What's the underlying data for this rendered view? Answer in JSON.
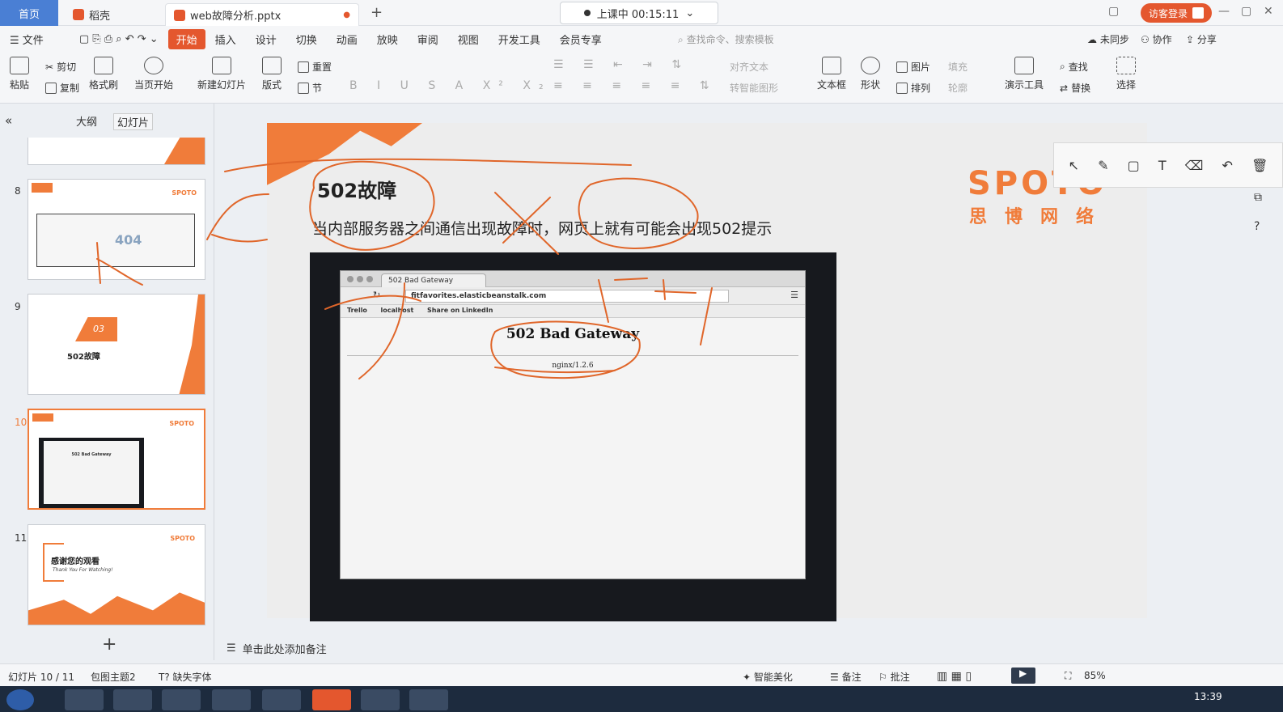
{
  "tabs": {
    "home": "首页",
    "daoke": "稻壳",
    "file": "web故障分析.pptx",
    "recording": "上课中 00:15:11",
    "login": "访客登录"
  },
  "menu": {
    "file": "文件",
    "items": [
      "开始",
      "插入",
      "设计",
      "切换",
      "动画",
      "放映",
      "审阅",
      "视图",
      "开发工具",
      "会员专享"
    ],
    "search_placeholder": "查找命令、搜索模板",
    "sync": "未同步",
    "collab": "协作",
    "share": "分享"
  },
  "ribbon": {
    "paste": "粘贴",
    "cut": "剪切",
    "copy": "复制",
    "format_painter": "格式刷",
    "from_current": "当页开始",
    "new_slide": "新建幻灯片",
    "layout": "版式",
    "reset": "重置",
    "section": "节",
    "align_text": "对齐文本",
    "smart_art": "转智能图形",
    "textbox": "文本框",
    "shape": "形状",
    "picture": "图片",
    "arrange": "排列",
    "fill": "填充",
    "outline": "轮廓",
    "presenter": "演示工具",
    "find": "查找",
    "replace": "替换",
    "select": "选择"
  },
  "left_panel": {
    "outline_tab": "大纲",
    "slides_tab": "幻灯片",
    "thumbs": [
      {
        "num": "8",
        "text": "404"
      },
      {
        "num": "9",
        "text": "502故障",
        "badge": "03"
      },
      {
        "num": "10",
        "text": "502 Bad Gateway"
      },
      {
        "num": "11",
        "text": "感谢您的观看",
        "sub": "Thank You For Watching!"
      }
    ]
  },
  "slide": {
    "title": "502故障",
    "body": "当内部服务器之间通信出现故障时，网页上就有可能会出现502提示",
    "brand": "SPOTO",
    "brand_sub": "思博网络",
    "browser": {
      "tab": "502 Bad Gateway",
      "url": "fitfavorites.elasticbeanstalk.com",
      "bookmarks": [
        "Trello",
        "localhost",
        "Share on LinkedIn"
      ],
      "error_title": "502 Bad Gateway",
      "error_sub": "nginx/1.2.6"
    }
  },
  "notes_placeholder": "单击此处添加备注",
  "status": {
    "slide_count": "幻灯片 10 / 11",
    "theme": "包图主题2",
    "missing_font": "缺失字体",
    "beautify": "智能美化",
    "notes": "备注",
    "comments": "批注",
    "zoom": "85%"
  },
  "taskbar": {
    "clock": "13:39"
  },
  "colors": {
    "accent": "#e4572e",
    "brand": "#f07c3a",
    "ink": "#e0662a"
  }
}
